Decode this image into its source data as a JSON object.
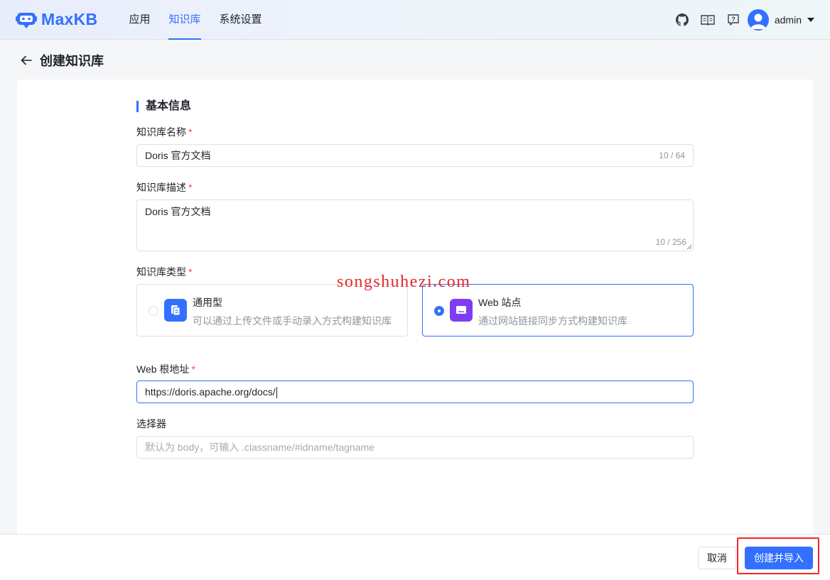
{
  "app": {
    "name": "MaxKB",
    "brand_color": "#3370ff"
  },
  "nav": {
    "items": [
      {
        "label": "应用",
        "active": false
      },
      {
        "label": "知识库",
        "active": true
      },
      {
        "label": "系统设置",
        "active": false
      }
    ]
  },
  "header_icons": [
    "github-icon",
    "book-icon",
    "help-icon"
  ],
  "user": {
    "name": "admin"
  },
  "page": {
    "title": "创建知识库"
  },
  "form": {
    "section_title": "基本信息",
    "name": {
      "label": "知识库名称",
      "value": "Doris 官方文档",
      "counter": "10 / 64"
    },
    "description": {
      "label": "知识库描述",
      "value": "Doris 官方文档",
      "counter": "10 / 256"
    },
    "type": {
      "label": "知识库类型",
      "options": [
        {
          "name": "通用型",
          "desc": "可以通过上传文件或手动录入方式构建知识库",
          "selected": false,
          "icon": "document-icon",
          "icon_color": "#3370ff"
        },
        {
          "name": "Web 站点",
          "desc": "通过网站链接同步方式构建知识库",
          "selected": true,
          "icon": "web-icon",
          "icon_color": "#7f3bf5"
        }
      ]
    },
    "web_url": {
      "label": "Web 根地址",
      "value": "https://doris.apache.org/docs/"
    },
    "selector": {
      "label": "选择器",
      "placeholder": "默认为 body，可输入 .classname/#idname/tagname"
    },
    "required_mark": "*"
  },
  "footer": {
    "cancel_label": "取消",
    "submit_label": "创建并导入"
  },
  "watermark": "songshuhezi.com"
}
